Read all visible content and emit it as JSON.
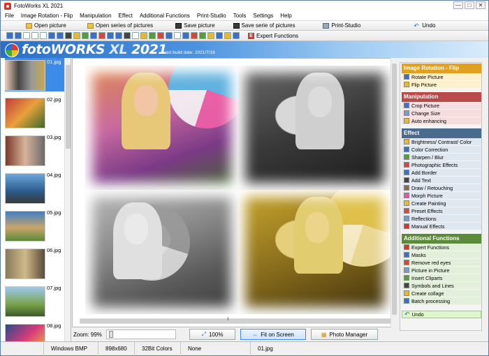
{
  "window": {
    "title": "FotoWorks XL 2021",
    "controls": [
      "—",
      "□",
      "✕"
    ]
  },
  "menu": [
    "File",
    "Image Rotation - Flip",
    "Manipulation",
    "Effect",
    "Additional Functions",
    "Print-Studio",
    "Tools",
    "Settings",
    "Help"
  ],
  "quickbar": {
    "open_picture": "Open picture",
    "open_series": "Open series of pictures",
    "save_picture": "Save picture",
    "save_series": "Save serie of pictures",
    "print_studio": "Print-Studio",
    "undo": "Undo"
  },
  "toolbar": {
    "expert_label": "Expert Functions",
    "expert_badge": "E"
  },
  "brand": {
    "logo_foto": "foto",
    "logo_works": "WORKS",
    "logo_xl": "XL",
    "logo_year": "2021",
    "build": "Last build date: 2021/7/16"
  },
  "thumbnails": [
    {
      "name": "01.jpg",
      "selected": true
    },
    {
      "name": "02.jpg",
      "selected": false
    },
    {
      "name": "03.jpg",
      "selected": false
    },
    {
      "name": "04.jpg",
      "selected": false
    },
    {
      "name": "05.jpg",
      "selected": false
    },
    {
      "name": "06.jpg",
      "selected": false
    },
    {
      "name": "07.jpg",
      "selected": false
    },
    {
      "name": "08.jpg",
      "selected": false
    }
  ],
  "zoom": {
    "label": "Zoom: 99%",
    "btn_100": "100%",
    "btn_fit": "Fit on Screen",
    "btn_manager": "Photo Manager"
  },
  "panel": {
    "sections": [
      {
        "title": "Image Rotation - Flip",
        "color": "#e0a020",
        "bg": "#fdf0cc",
        "items": [
          "Rotate Picture",
          "Flip Picture"
        ]
      },
      {
        "title": "Manipulation",
        "color": "#b84a4a",
        "bg": "#f6dede",
        "items": [
          "Crop Picture",
          "Change Size",
          "Auto enhancing"
        ]
      },
      {
        "title": "Effect",
        "color": "#4a6a8e",
        "bg": "#dfe7f0",
        "items": [
          "Brightness/ Contrast/ Color",
          "Color Correction",
          "Sharpen / Blur",
          "Photographic Effects",
          "Add Border",
          "Add Text",
          "Draw / Retouching",
          "Morph Picture",
          "Create Painting",
          "Preset Effects",
          "Reflections",
          "Manual Effects"
        ]
      },
      {
        "title": "Additional Functions",
        "color": "#5a8a3a",
        "bg": "#e2efda",
        "items": [
          "Expert Functions",
          "Masks",
          "Remove red eyes",
          "Picture in Picture",
          "Insert Cliparts",
          "Symbols and Lines",
          "Create collage",
          "Batch processing"
        ]
      }
    ],
    "undo": "Undo"
  },
  "status": {
    "format": "Windows BMP",
    "dimensions": "898x680",
    "colors": "32Bit Colors",
    "compression": "None",
    "filename": "01.jpg"
  }
}
